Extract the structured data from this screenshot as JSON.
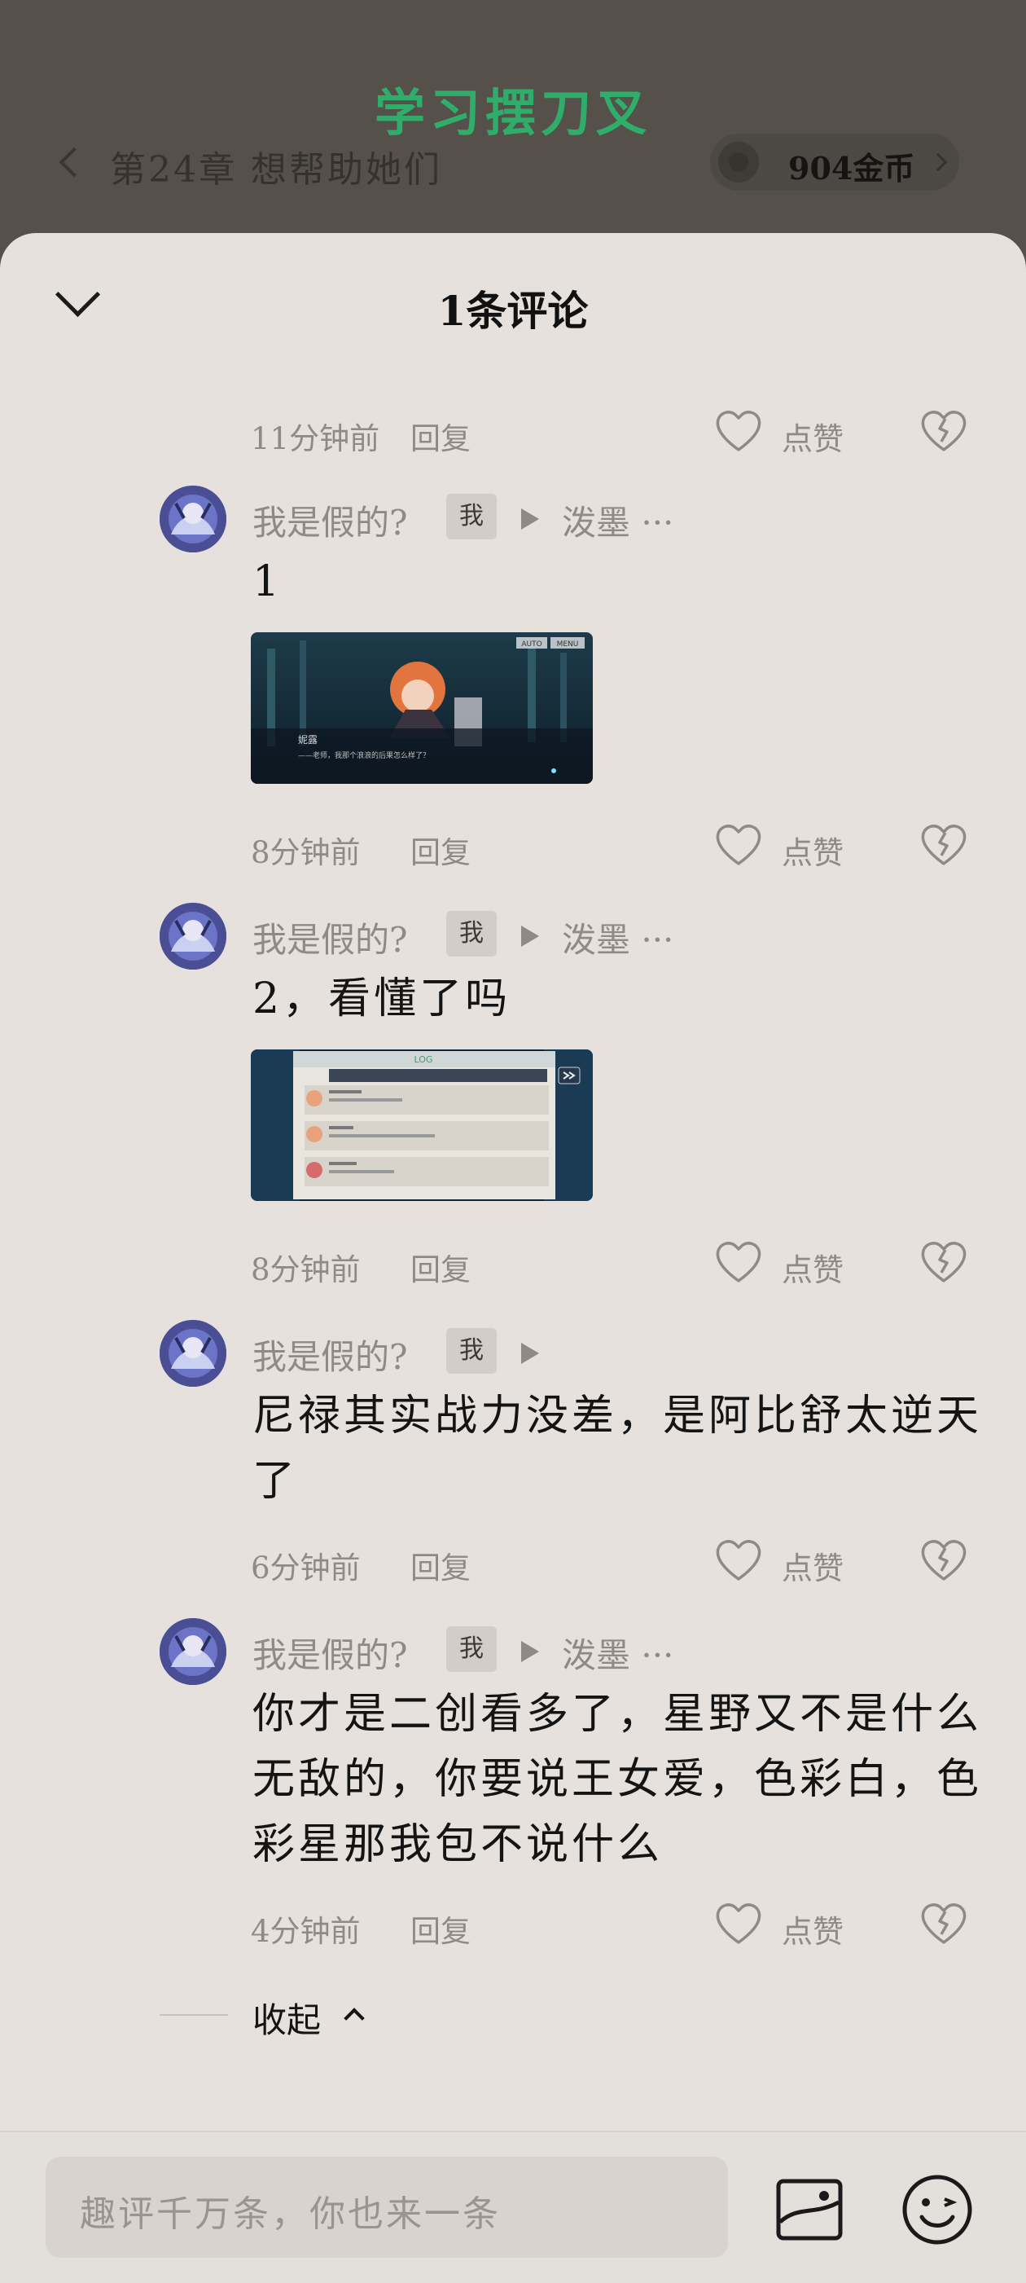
{
  "header": {
    "app_title": "学习摆刀叉",
    "chapter_title": "第24章  想帮助她们",
    "coin_label": "904金币"
  },
  "sheet": {
    "title": "1条评论"
  },
  "top_meta": {
    "time": "11分钟前",
    "reply_label": "回复",
    "like_label": "点赞"
  },
  "comments": [
    {
      "username": "我是假的?",
      "badge": "我",
      "reply_to": "泼墨 ···",
      "text_lines": [
        "1"
      ],
      "time": "8分钟前",
      "reply_label": "回复",
      "like_label": "点赞",
      "image": {
        "caption_name": "妮露",
        "caption_text": "——老师，我那个浪浪的后果怎么样了？",
        "btn_auto": "AUTO",
        "btn_menu": "MENU"
      }
    },
    {
      "username": "我是假的?",
      "badge": "我",
      "reply_to": "泼墨 ···",
      "text_lines": [
        "2，看懂了吗"
      ],
      "time": "8分钟前",
      "reply_label": "回复",
      "like_label": "点赞",
      "image": {
        "log_title": "LOG"
      }
    },
    {
      "username": "我是假的?",
      "badge": "我",
      "reply_to": "",
      "text_lines": [
        "尼禄其实战力没差，是阿比舒太逆天",
        "了"
      ],
      "time": "6分钟前",
      "reply_label": "回复",
      "like_label": "点赞"
    },
    {
      "username": "我是假的?",
      "badge": "我",
      "reply_to": "泼墨 ···",
      "text_lines": [
        "你才是二创看多了，星野又不是什么",
        "无敌的，你要说王女爱，色彩白，色",
        "彩星那我包不说什么"
      ],
      "time": "4分钟前",
      "reply_label": "回复",
      "like_label": "点赞"
    }
  ],
  "collapse_label": "收起",
  "input": {
    "placeholder": "趣评千万条，你也来一条"
  },
  "colors": {
    "title_green": "#2fae6b",
    "sheet_bg": "#e6e1dc",
    "muted_text": "#8f8a85"
  },
  "icons": [
    "back-chevron-icon",
    "coin-icon",
    "chevron-right-icon",
    "collapse-chevron-icon",
    "heart-icon",
    "broken-heart-icon",
    "image-icon",
    "emoji-icon"
  ]
}
